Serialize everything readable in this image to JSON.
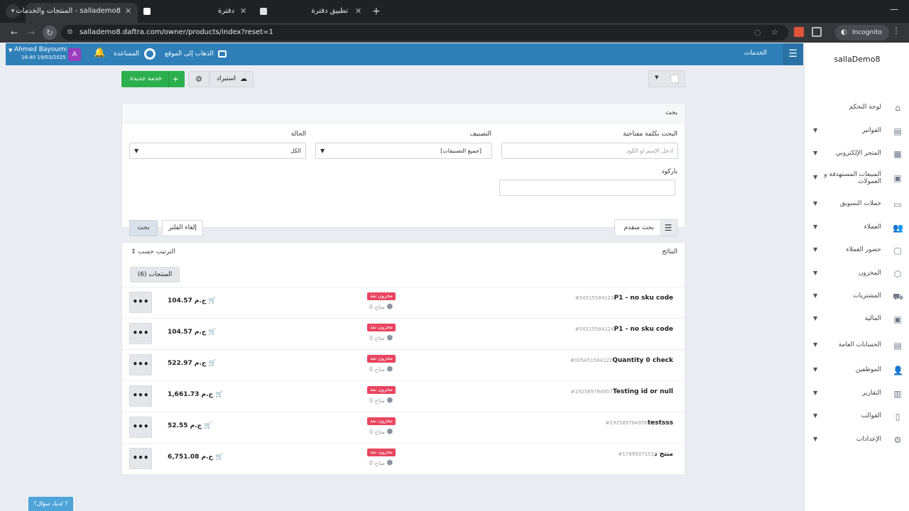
{
  "browser": {
    "tabs": [
      {
        "title": "المنتجات والخدمات - sallademo8",
        "active": true
      },
      {
        "title": "دفترة",
        "active": false
      },
      {
        "title": "تطبيق دفترة",
        "active": false
      }
    ],
    "url": "sallademo8.daftra.com/owner/products/index?reset=1",
    "incognito_label": "Incognito"
  },
  "topbar": {
    "user_name": "Ahmed Bayoumi",
    "user_datetime": "16:40 19/03/2025",
    "avatar_letter": "A",
    "help_label": "المساعدة",
    "goto_site_label": "الذهاب إلى الموقع",
    "section_title": "الخدمات"
  },
  "sidebar": {
    "brand": "sallaDemo8",
    "items": [
      {
        "label": "لوحة التحكم",
        "icon": "home-icon",
        "has_children": false
      },
      {
        "label": "الفواتير",
        "icon": "invoice-icon",
        "has_children": true
      },
      {
        "label": "المتجر الإلكتروني",
        "icon": "store-icon",
        "has_children": true
      },
      {
        "label_line1": "المبيعات المستهدفة و",
        "label_line2": "العمولات",
        "icon": "money-icon",
        "has_children": true
      },
      {
        "label": "حملات التسويق",
        "icon": "clipboard-icon",
        "has_children": true
      },
      {
        "label": "العملاء",
        "icon": "users-icon",
        "has_children": true
      },
      {
        "label": "حضور العملاء",
        "icon": "attendance-icon",
        "has_children": true
      },
      {
        "label": "المخزون",
        "icon": "box-icon",
        "has_children": true
      },
      {
        "label": "المشتريات",
        "icon": "truck-icon",
        "has_children": true
      },
      {
        "label": "المالية",
        "icon": "finance-icon",
        "has_children": true
      },
      {
        "label": "الحسابات العامة",
        "icon": "accounts-icon",
        "has_children": true
      },
      {
        "label": "الموظفين",
        "icon": "employees-icon",
        "has_children": true
      },
      {
        "label": "التقارير",
        "icon": "chart-icon",
        "has_children": true
      },
      {
        "label": "القوالب",
        "icon": "template-icon",
        "has_children": true
      },
      {
        "label": "الإعدادات",
        "icon": "gear-icon",
        "has_children": true
      }
    ]
  },
  "toolbar": {
    "new_service_label": "خدمة جديدة",
    "import_label": "استيراد"
  },
  "search_panel": {
    "title": "بحث",
    "keyword_label": "البحث بكلمة مفتاحية",
    "keyword_placeholder": "ادخل الإسم او الكود",
    "category_label": "التصنيف",
    "category_value": "[جميع التصنيفات]",
    "status_label": "الحالة",
    "status_value": "الكل",
    "barcode_label": "باركود",
    "advanced_label": "بحث متقدم",
    "clear_label": "إلغاء الفلتر",
    "search_label": "بحث"
  },
  "results": {
    "title": "النتائج",
    "sort_label": "الترتيب حسب",
    "products_tab": "المنتجات (6)",
    "rows": [
      {
        "name": "P1 - no sku code",
        "code": "#54515584123",
        "badge": "مخزون نفذ",
        "stock": "0 متاح",
        "price": "104.57 ج.م"
      },
      {
        "name": "P1 - no sku code",
        "code": "#54515584124",
        "badge": "مخزون نفذ",
        "stock": "0 متاح",
        "price": "104.57 ج.م"
      },
      {
        "name": "Quantity 0 check",
        "code": "#005451584122",
        "badge": "مخزون نفذ",
        "stock": "0 متاح",
        "price": "522.97 ج.م"
      },
      {
        "name": "Testing id or null",
        "code": "#192589784957",
        "badge": "مخزون نفذ",
        "stock": "0 متاح",
        "price": "1,661.73 ج.م"
      },
      {
        "name": "testsss",
        "code": "#192589784956",
        "badge": "مخزون نفذ",
        "stock": "0 متاح",
        "price": "52.55 ج.م"
      },
      {
        "name": "منتج د",
        "code": "#1789937153",
        "badge": "مخزون نفذ",
        "stock": "0 متاح",
        "price": "6,751.08 ج.م"
      }
    ]
  },
  "help_widget": "لديك سؤال؟",
  "colors": {
    "topbar": "#2f80b9",
    "primary_green": "#2cb04e",
    "badge_red": "#e9455f",
    "browser_dark": "#202124"
  }
}
